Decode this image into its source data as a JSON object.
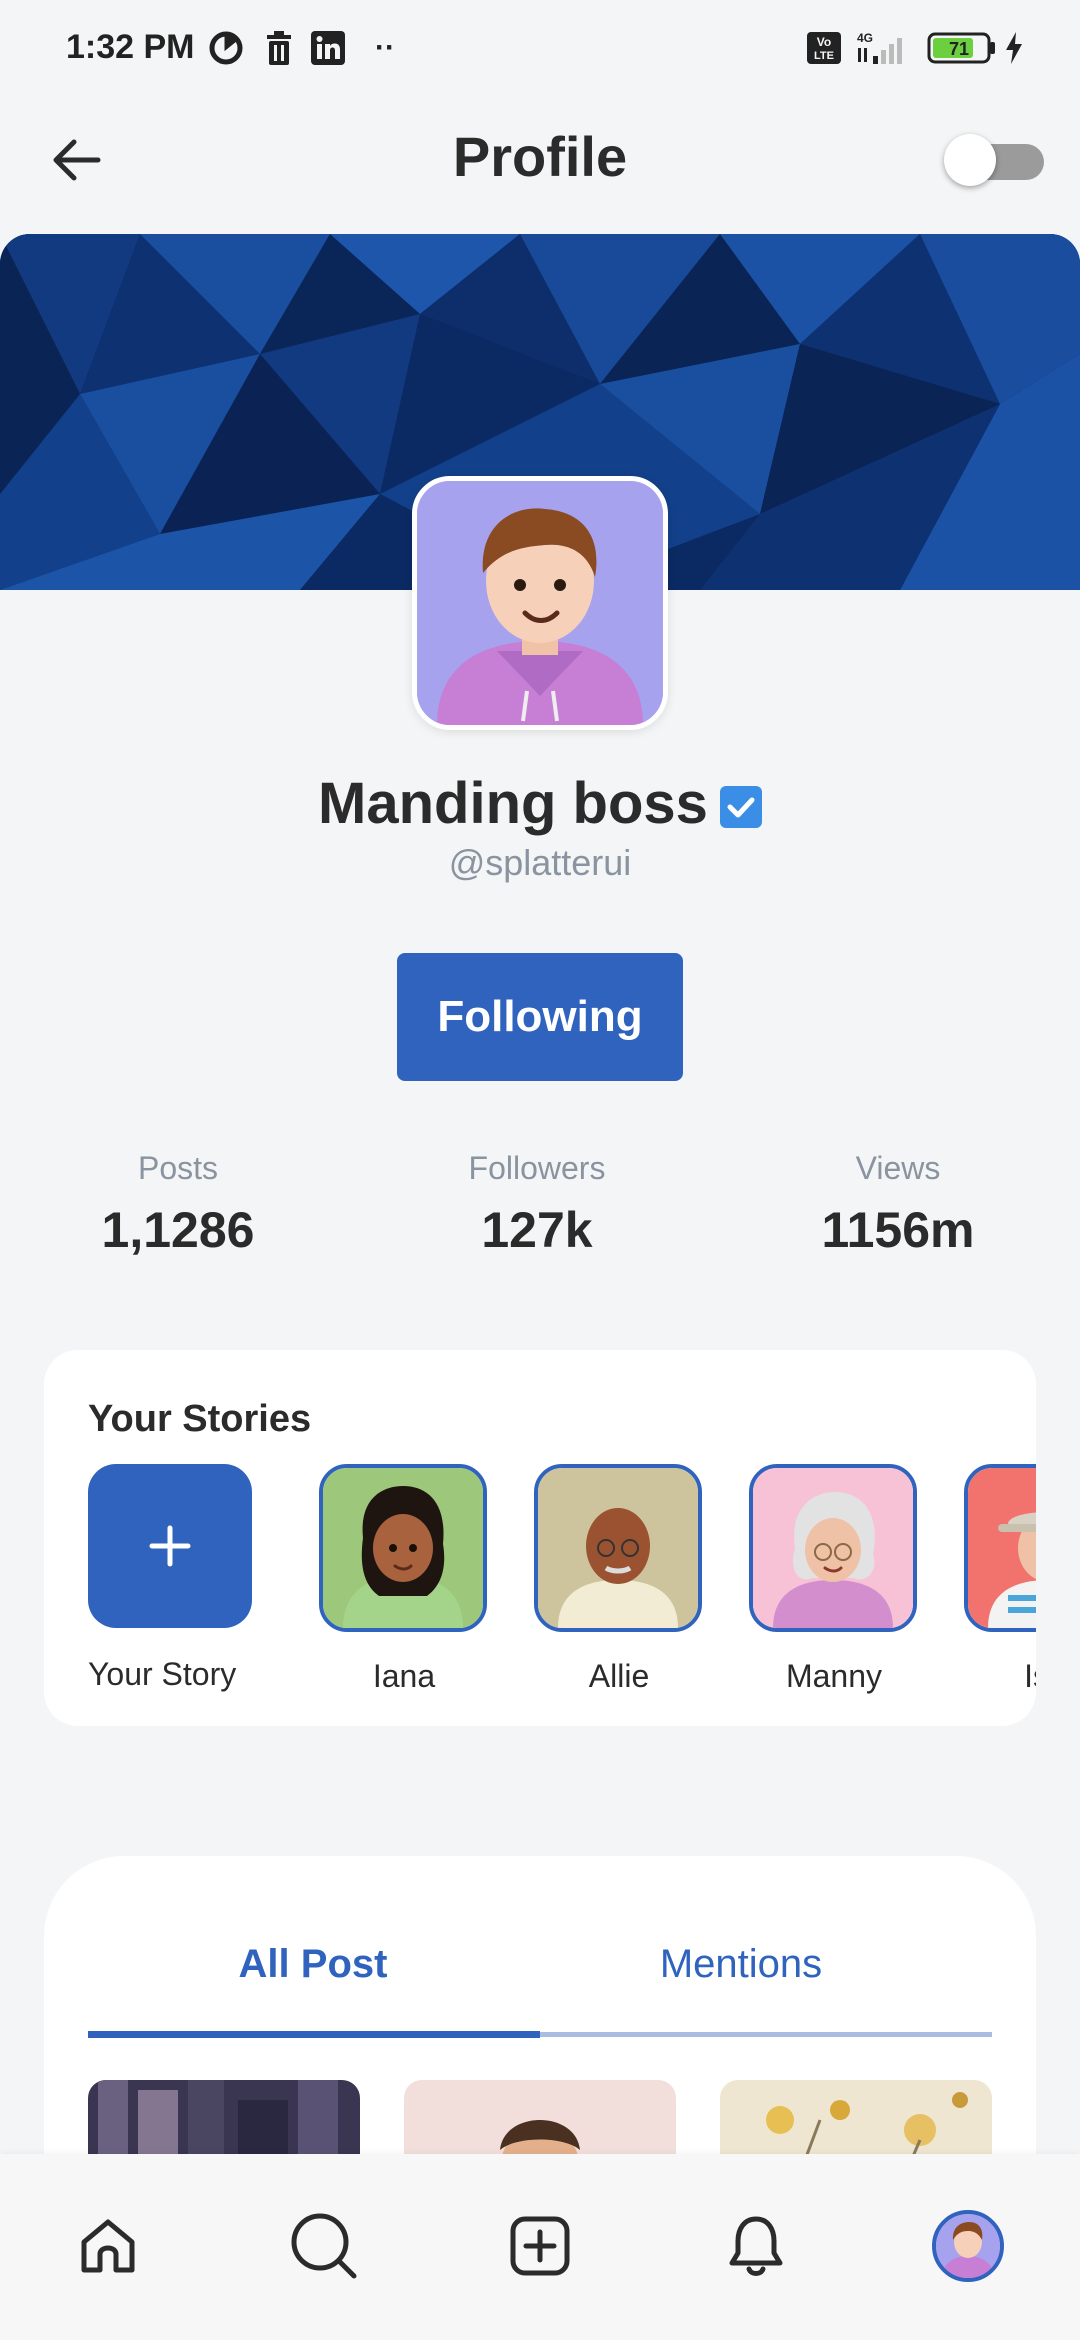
{
  "status_bar": {
    "time": "1:32 PM",
    "more": "··",
    "battery_level": "71",
    "icons": [
      "sync-icon",
      "trash-icon",
      "linkedin-icon",
      "volte-icon",
      "signal-icon",
      "battery-icon",
      "charging-icon"
    ]
  },
  "header": {
    "title": "Profile",
    "back_icon": "arrow-left-icon",
    "theme_toggle_on": false
  },
  "profile": {
    "name": "Manding boss",
    "handle": "@splatterui",
    "verified": true,
    "follow_button": "Following"
  },
  "stats": [
    {
      "label": "Posts",
      "value": "1,1286"
    },
    {
      "label": "Followers",
      "value": "127k"
    },
    {
      "label": "Views",
      "value": "1156m"
    }
  ],
  "stories": {
    "title": "Your Stories",
    "add_label": "Your Story",
    "items": [
      {
        "name": "Iana",
        "bg": "#9dc77a"
      },
      {
        "name": "Allie",
        "bg": "#cdc39c"
      },
      {
        "name": "Manny",
        "bg": "#f7c2d6"
      },
      {
        "name": "Isal",
        "bg": "#f2736e"
      }
    ]
  },
  "posts": {
    "tabs": [
      "All Post",
      "Mentions"
    ],
    "active_tab": "All Post"
  },
  "bottom_nav": [
    "home-icon",
    "search-icon",
    "add-post-icon",
    "bell-icon",
    "profile-avatar"
  ],
  "colors": {
    "accent": "#2f63bd",
    "background": "#f4f5f6",
    "cover": "#0c2d66"
  }
}
